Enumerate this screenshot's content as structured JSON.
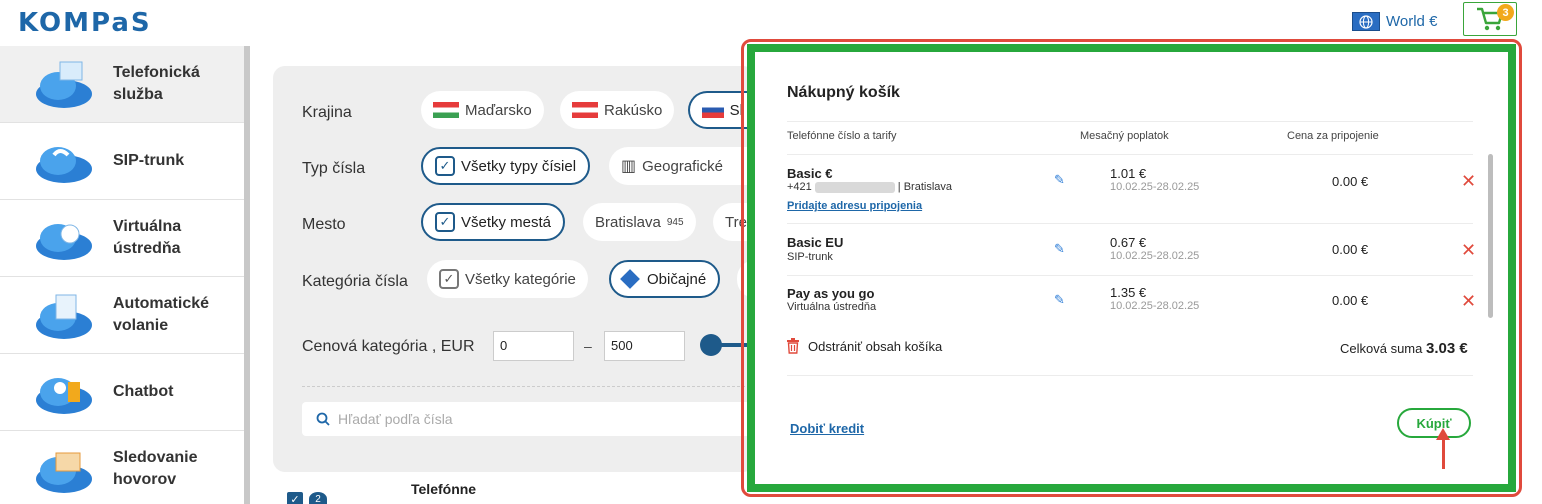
{
  "header": {
    "logo": "KOMPaS",
    "region_label": "World €",
    "cart_count": "3"
  },
  "sidebar": {
    "items": [
      {
        "label": "Telefonická služba",
        "icon": "phone-service-cloud-icon"
      },
      {
        "label": "SIP-trunk",
        "icon": "sip-trunk-cloud-icon"
      },
      {
        "label": "Virtuálna ústredňa",
        "icon": "virtual-pbx-cloud-icon"
      },
      {
        "label": "Automatické volanie",
        "icon": "auto-dialer-cloud-icon"
      },
      {
        "label": "Chatbot",
        "icon": "chatbot-cloud-icon"
      },
      {
        "label": "Sledovanie hovorov",
        "icon": "call-tracking-cloud-icon"
      }
    ]
  },
  "filters": {
    "country_label": "Krajina",
    "countries": [
      "Maďarsko",
      "Rakúsko",
      "Sl"
    ],
    "number_type_label": "Typ čísla",
    "number_types": [
      "Všetky typy čísiel",
      "Geografické"
    ],
    "city_label": "Mesto",
    "cities": [
      "Všetky mestá",
      "Bratislava",
      "Tre"
    ],
    "bratislava_count": "945",
    "category_label": "Kategória čísla",
    "categories": [
      "Všetky kategórie",
      "Običajné"
    ],
    "price_label": "Cenová kategória , EUR",
    "price_min": "0",
    "price_max": "500",
    "search_placeholder": "Hľadať podľa čísla"
  },
  "list_header": {
    "badge_num": "2",
    "col_phone": "Telefónne"
  },
  "cart": {
    "title": "Nákupný košík",
    "col_phone": "Telefónne číslo a tarify",
    "col_monthly": "Mesačný poplatok",
    "col_connection": "Cena za pripojenie",
    "items": [
      {
        "name": "Basic €",
        "number_prefix": "+421",
        "city": "| Bratislava",
        "link": "Pridajte adresu pripojenia",
        "monthly": "1.01 €",
        "period": "10.02.25-28.02.25",
        "connection": "0.00 €"
      },
      {
        "name": "Basic EU",
        "sub": "SIP-trunk",
        "monthly": "0.67 €",
        "period": "10.02.25-28.02.25",
        "connection": "0.00 €"
      },
      {
        "name": "Pay as you go",
        "sub": "Virtuálna ústredňa",
        "monthly": "1.35 €",
        "period": "10.02.25-28.02.25",
        "connection": "0.00 €"
      }
    ],
    "clear_label": "Odstrániť obsah košíka",
    "total_label": "Celková suma",
    "total_value": "3.03 €",
    "topup_label": "Dobiť kredit",
    "buy_label": "Kúpiť"
  },
  "colors": {
    "brand": "#1e67a8",
    "annotation_red": "#e04a3c",
    "annotation_green": "#27a83c"
  }
}
